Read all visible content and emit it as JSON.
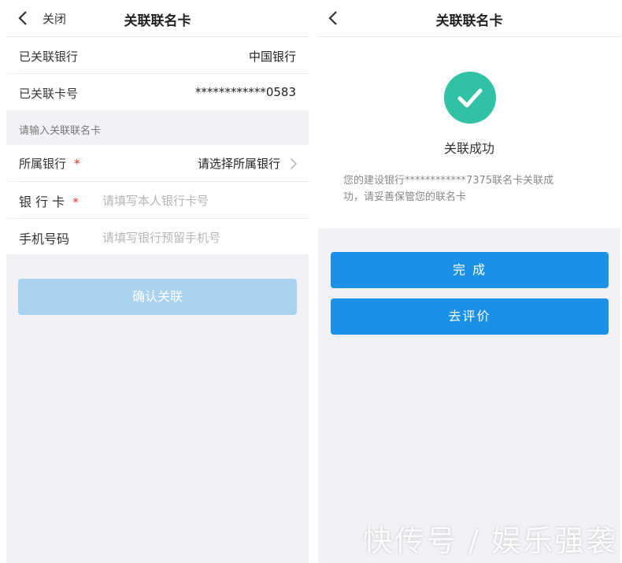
{
  "left": {
    "header": {
      "close": "关闭",
      "title": "关联联名卡"
    },
    "linked_bank": {
      "label": "已关联银行",
      "value": "中国银行"
    },
    "linked_card": {
      "label": "已关联卡号",
      "value": "************0583"
    },
    "section_heading": "请输入关联联名卡",
    "bank_field": {
      "label": "所属银行",
      "required_mark": "*",
      "value": "请选择所属银行"
    },
    "card_field": {
      "label": "银 行 卡",
      "required_mark": "*",
      "placeholder": "请填写本人银行卡号"
    },
    "phone_field": {
      "label": "手机号码",
      "placeholder": "请填写银行预留手机号"
    },
    "confirm_button": "确认关联"
  },
  "right": {
    "header": {
      "title": "关联联名卡"
    },
    "status_title": "关联成功",
    "message_line1": "您的建设银行************7375联名卡关联成",
    "message_line2": "功，请妥善保管您的联名卡",
    "done_button": "完 成",
    "review_button": "去评价"
  },
  "watermark": "快传号 / 娱乐强袭",
  "icons": [
    "back-icon",
    "chevron-right-icon",
    "check-icon"
  ],
  "colors": {
    "primary": "#1a91e6",
    "disabled": "#a9d2f0",
    "success": "#2fc2a4",
    "required": "#e03030"
  }
}
